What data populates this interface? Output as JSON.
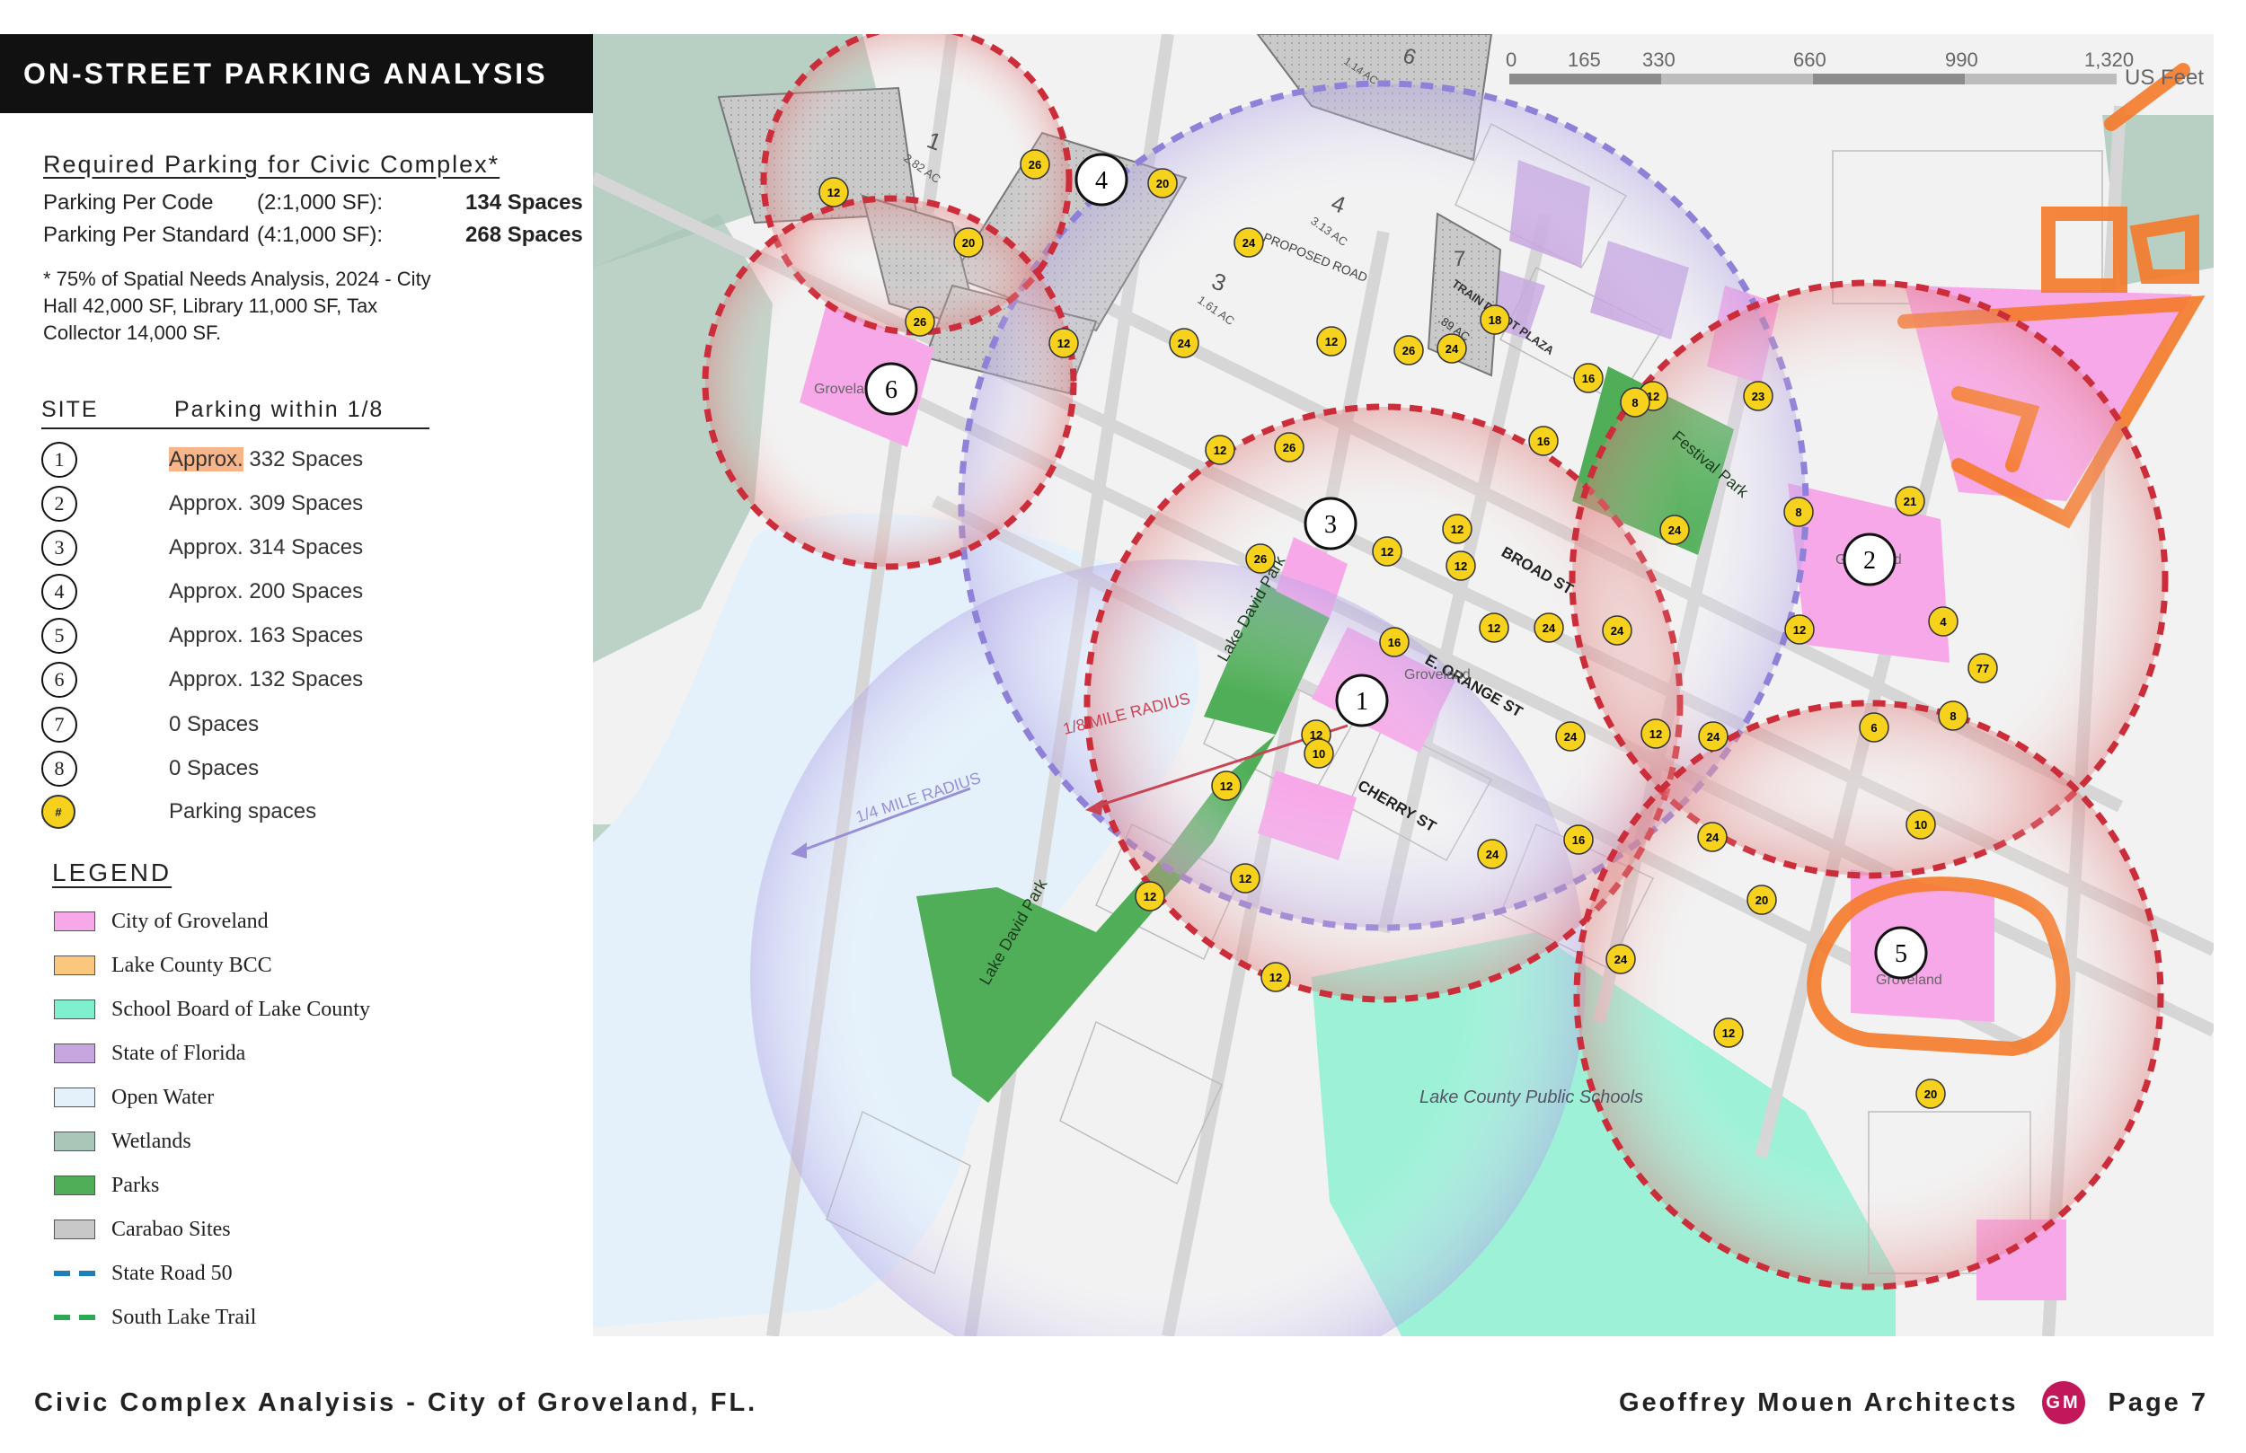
{
  "title": "ON-STREET PARKING ANALYSIS",
  "required": {
    "heading": "Required Parking for Civic Complex*",
    "rows": [
      {
        "label": "Parking Per Code",
        "ratio": "(2:1,000 SF):",
        "value": "134 Spaces"
      },
      {
        "label": "Parking Per Standard",
        "ratio": "(4:1,000 SF):",
        "value": "268 Spaces"
      }
    ],
    "footnote": "* 75% of Spatial Needs Analysis, 2024 - City Hall 42,000 SF, Library 11,000 SF, Tax Collector 14,000 SF."
  },
  "sites": {
    "heading_site": "SITE",
    "heading_within": "Parking within 1/8",
    "rows": [
      {
        "num": "1",
        "highlight": "Approx.",
        "text": " 332 Spaces"
      },
      {
        "num": "2",
        "highlight": "",
        "text": "Approx. 309 Spaces"
      },
      {
        "num": "3",
        "highlight": "",
        "text": "Approx. 314 Spaces"
      },
      {
        "num": "4",
        "highlight": "",
        "text": "Approx. 200 Spaces"
      },
      {
        "num": "5",
        "highlight": "",
        "text": "Approx. 163 Spaces"
      },
      {
        "num": "6",
        "highlight": "",
        "text": "Approx. 132 Spaces"
      },
      {
        "num": "7",
        "highlight": "",
        "text": "0 Spaces"
      },
      {
        "num": "8",
        "highlight": "",
        "text": "0 Spaces"
      }
    ],
    "parking_symbol": "#",
    "parking_label": "Parking spaces"
  },
  "legend": {
    "title": "LEGEND",
    "items": [
      {
        "label": "City of Groveland",
        "color": "#f7a8e8",
        "kind": "fill"
      },
      {
        "label": "Lake County BCC",
        "color": "#fbc77d",
        "kind": "fill"
      },
      {
        "label": "School Board of Lake County",
        "color": "#7ff0cd",
        "kind": "fill"
      },
      {
        "label": "State of Florida",
        "color": "#c7a6e0",
        "kind": "fill"
      },
      {
        "label": "Open Water",
        "color": "#e4f1fb",
        "kind": "fill"
      },
      {
        "label": "Wetlands",
        "color": "#a9c7b8",
        "kind": "fill"
      },
      {
        "label": "Parks",
        "color": "#4fae57",
        "kind": "fill"
      },
      {
        "label": "Carabao Sites",
        "color": "#c8c8c8",
        "kind": "fill"
      },
      {
        "label": "State Road 50",
        "color": "#1f7fb8",
        "kind": "dash"
      },
      {
        "label": "South Lake Trail",
        "color": "#2aa853",
        "kind": "dash"
      }
    ]
  },
  "map": {
    "scale_ticks": [
      "0",
      "165",
      "330",
      "660",
      "990",
      "1,320"
    ],
    "scale_unit": "US Feet",
    "streets": [
      "BROAD ST",
      "E. ORANGE ST",
      "CHERRY ST",
      "PROPOSED ROAD"
    ],
    "parks": [
      "Lake David Park",
      "Lake David Park",
      "Festival Park"
    ],
    "radius_eighth": "1/8 MILE RADIUS",
    "radius_quarter": "1/4 MILE RADIUS",
    "schools_label": "Lake County Public Schools",
    "train_depot": "TRAIN DEPOT PLAZA",
    "train_depot_area": ".89 AC",
    "carabao": [
      {
        "num": "1",
        "area": "2.82 AC"
      },
      {
        "num": "3",
        "area": "1.61 AC"
      },
      {
        "num": "4",
        "area": "3.13 AC"
      },
      {
        "num": "6",
        "area": "1.14 AC"
      },
      {
        "num": "7",
        "area": ""
      }
    ],
    "site_labels": [
      "1",
      "2",
      "3",
      "4",
      "5",
      "6"
    ],
    "groveland": "Groveland",
    "parking_values": [
      "12",
      "26",
      "20",
      "26",
      "12",
      "24",
      "12",
      "26",
      "18",
      "24",
      "20",
      "24",
      "12",
      "26",
      "16",
      "12",
      "8",
      "23",
      "8",
      "24",
      "21",
      "16",
      "12",
      "12",
      "26",
      "24",
      "12",
      "16",
      "12",
      "24",
      "12",
      "4",
      "77",
      "10",
      "12",
      "24",
      "6",
      "8",
      "12",
      "24",
      "24",
      "10",
      "12",
      "16",
      "12",
      "12",
      "24",
      "20",
      "12",
      "24",
      "12",
      "20"
    ]
  },
  "footer": {
    "left": "Civic Complex Analyisis - City of Groveland, FL.",
    "firm": "Geoffrey Mouen Architects",
    "page": "Page 7"
  }
}
